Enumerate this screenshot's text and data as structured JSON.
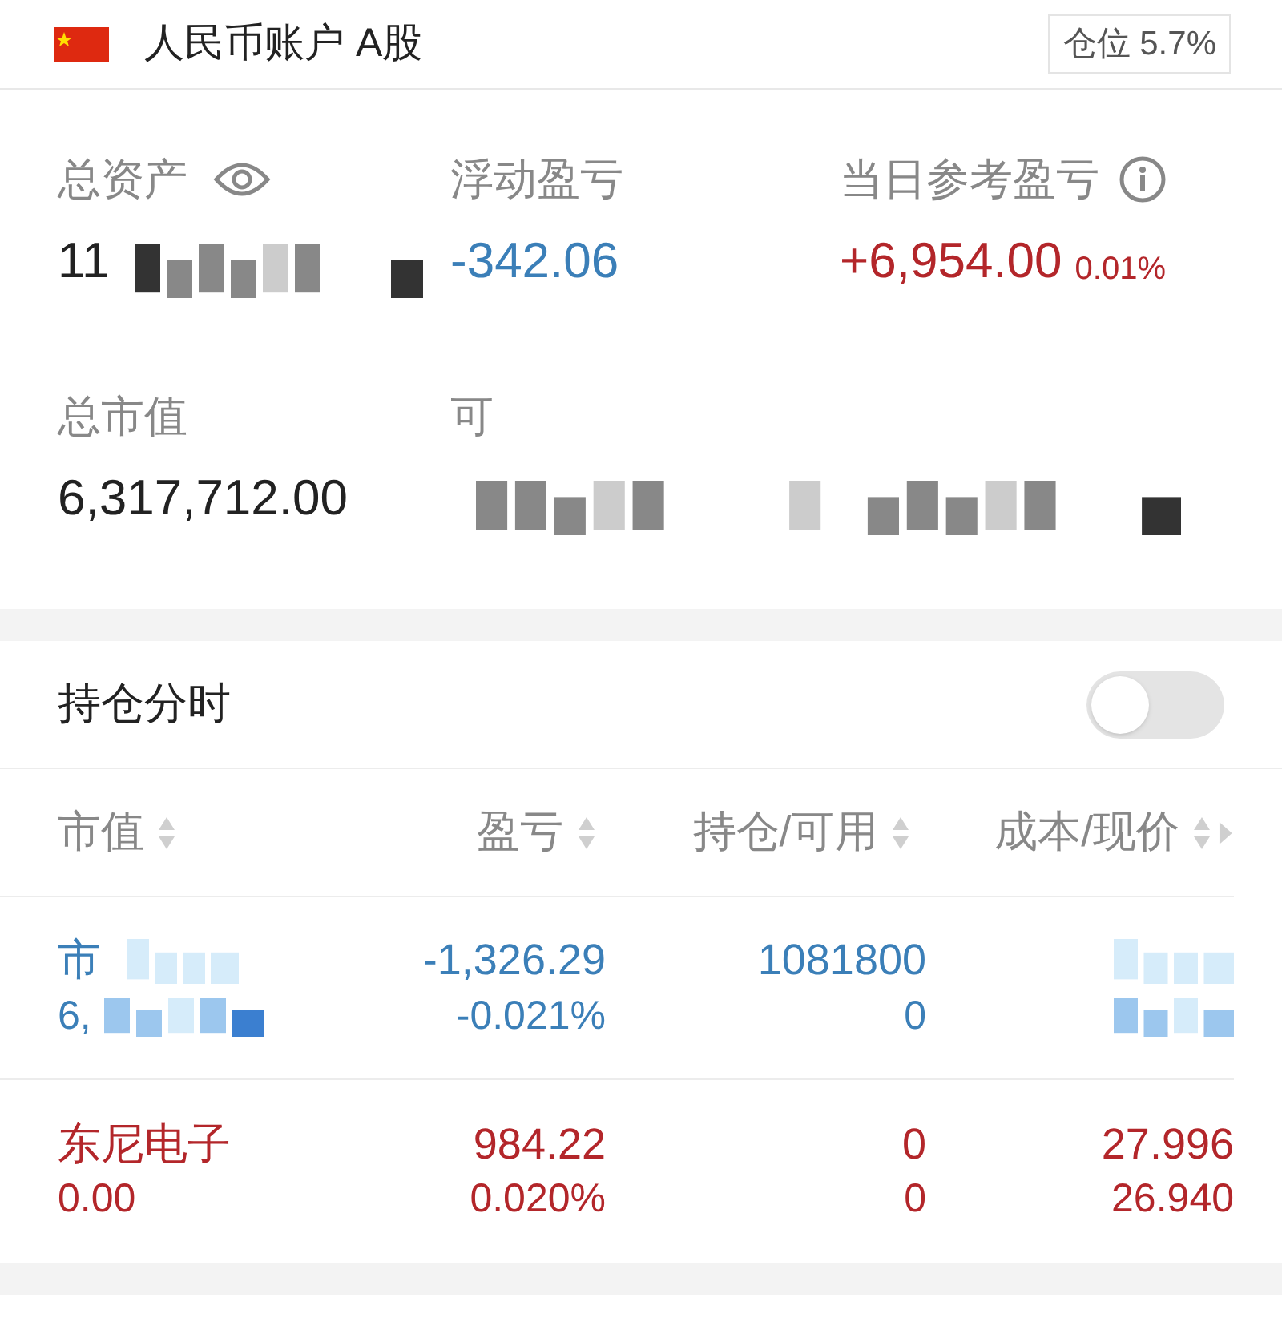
{
  "account": {
    "title": "人民币账户 A股",
    "position": "仓位 5.7%"
  },
  "stats": [
    {
      "label": "总资产",
      "value": "11",
      "color": "#222222",
      "mosaic": true
    },
    {
      "label": "浮动盈亏",
      "value": "-342.06",
      "color": "#3b7fb8"
    },
    {
      "label": "当日参考盈亏",
      "value": "+6,954.00",
      "extra": "0.01%",
      "color": "#b3262a"
    },
    {
      "label": "总市值",
      "value": "6,317,712.00",
      "color": "#222222"
    },
    {
      "label": "可",
      "mosaic": true
    }
  ],
  "intraday": {
    "label": "持仓分时",
    "on": false
  },
  "table": {
    "columns": [
      "市值",
      "盈亏",
      "持仓/可用",
      "成本/现价"
    ],
    "rows": [
      {
        "color": "#3b7fb8",
        "name": "市",
        "market_value": "6,",
        "pnl": "-1,326.29",
        "pnl_pct": "-0.021%",
        "holding": "1081800",
        "available": "0",
        "mosaic": true
      },
      {
        "color": "#b3262a",
        "name": "东尼电子",
        "market_value": "0.00",
        "pnl": "984.22",
        "pnl_pct": "0.020%",
        "holding": "0",
        "available": "0",
        "cost": "27.996",
        "price": "26.940"
      }
    ]
  }
}
